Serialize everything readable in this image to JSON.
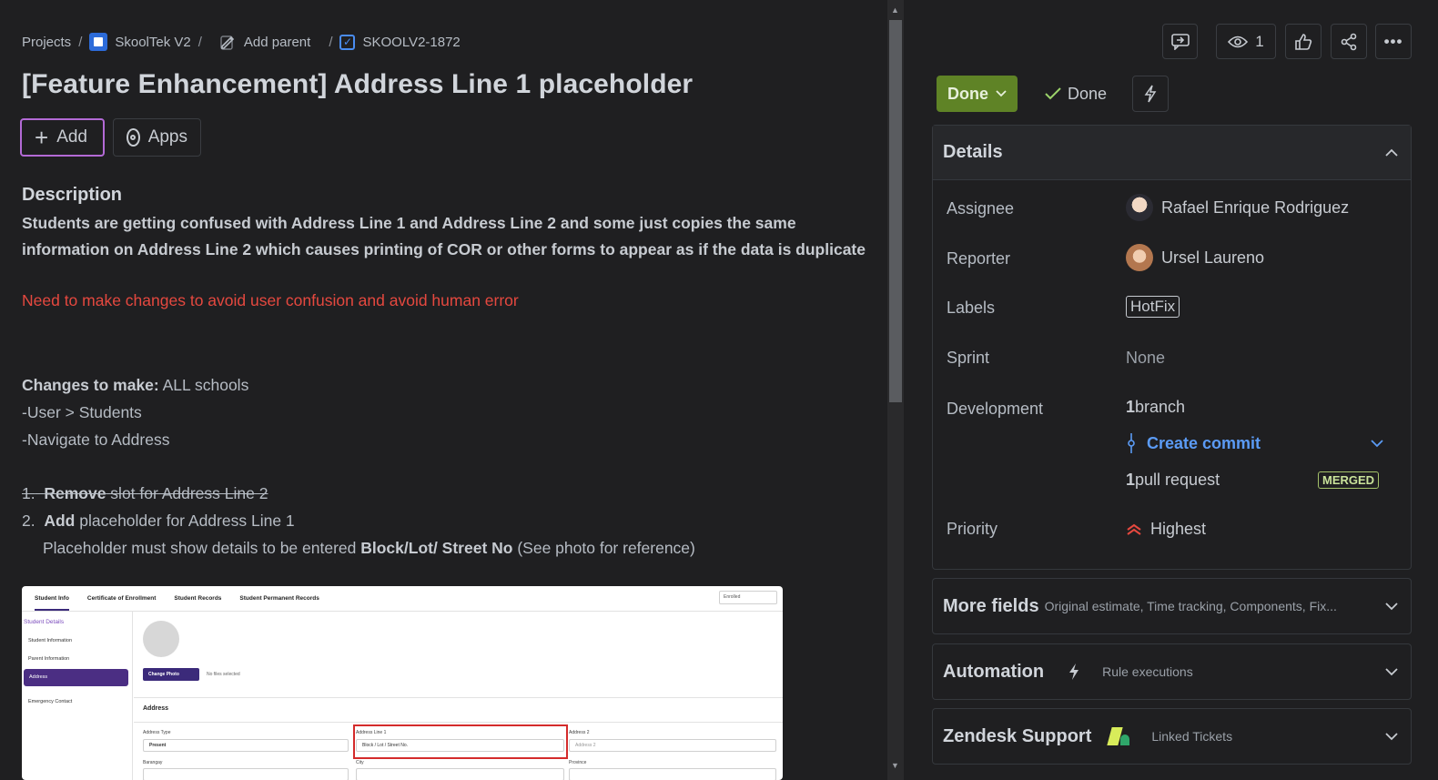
{
  "breadcrumb": {
    "projects": "Projects",
    "project": "SkoolTek V2",
    "add_parent": "Add parent",
    "issue_key": "SKOOLV2-1872",
    "sep": "/"
  },
  "issue": {
    "title": "[Feature Enhancement] Address Line 1 placeholder"
  },
  "actions": {
    "add": "Add",
    "apps": "Apps"
  },
  "description": {
    "heading": "Description",
    "bold_text": "Students are getting confused with Address Line 1 and Address Line 2 and some just copies the same information on Address Line 2 which causes printing of COR or other forms to appear as if the data is duplicate",
    "red_text": "Need to make changes to avoid user confusion and avoid human error",
    "changes_label": "Changes to make:",
    "changes_value": " ALL schools",
    "nav1": "-User > Students",
    "nav2": "-Navigate to Address",
    "step1_num": "1.",
    "step1_bold": "Remove",
    "step1_rest": " slot for Address Line 2 ",
    "step2_num": "2.",
    "step2_bold": "Add",
    "step2_rest": " placeholder for Address Line 1",
    "step2_detail_pre": "Placeholder must show details to be entered ",
    "step2_detail_bold": "Block/Lot/ Street No",
    "step2_detail_post": " (See photo for reference)"
  },
  "screenshot": {
    "tabs": [
      "Student Info",
      "Certificate of Enrollment",
      "Student Records",
      "Student Permanent Records"
    ],
    "enrolled": "Enrolled",
    "side_title": "Student Details",
    "side_items": [
      "Student Information",
      "Parent Information",
      "Address",
      "Emergency Contact"
    ],
    "change_photo": "Change Photo",
    "no_file": "No files selected",
    "section": "Address",
    "address_type_label": "Address Type",
    "address_type_value": "Present",
    "address1_label": "Address Line 1",
    "address1_placeholder": "Block / Lot / Street No.",
    "address2_label": "Address 2",
    "address2_placeholder": "Address 2",
    "barangay": "Barangay",
    "city": "City",
    "province": "Province"
  },
  "toolbar": {
    "watch_count": "1"
  },
  "status": {
    "button": "Done",
    "resolution": "Done"
  },
  "details": {
    "heading": "Details",
    "assignee_label": "Assignee",
    "assignee": "Rafael Enrique Rodriguez",
    "reporter_label": "Reporter",
    "reporter": "Ursel Laureno",
    "labels_label": "Labels",
    "label_tag": "HotFix",
    "sprint_label": "Sprint",
    "sprint": "None",
    "development_label": "Development",
    "branch_count": "1",
    "branch_text": " branch",
    "create_commit": "Create commit",
    "pr_count": "1",
    "pr_text": " pull request",
    "merged": "MERGED",
    "priority_label": "Priority",
    "priority": "Highest"
  },
  "more_fields": {
    "heading": "More fields",
    "sub": "Original estimate, Time tracking, Components, Fix..."
  },
  "automation": {
    "heading": "Automation",
    "sub": "Rule executions"
  },
  "zendesk": {
    "heading": "Zendesk Support",
    "sub": "Linked Tickets"
  },
  "colors": {
    "done": "#5f8326",
    "link": "#5b9bf5",
    "red": "#e5483f",
    "add_border": "#b36ad6"
  }
}
